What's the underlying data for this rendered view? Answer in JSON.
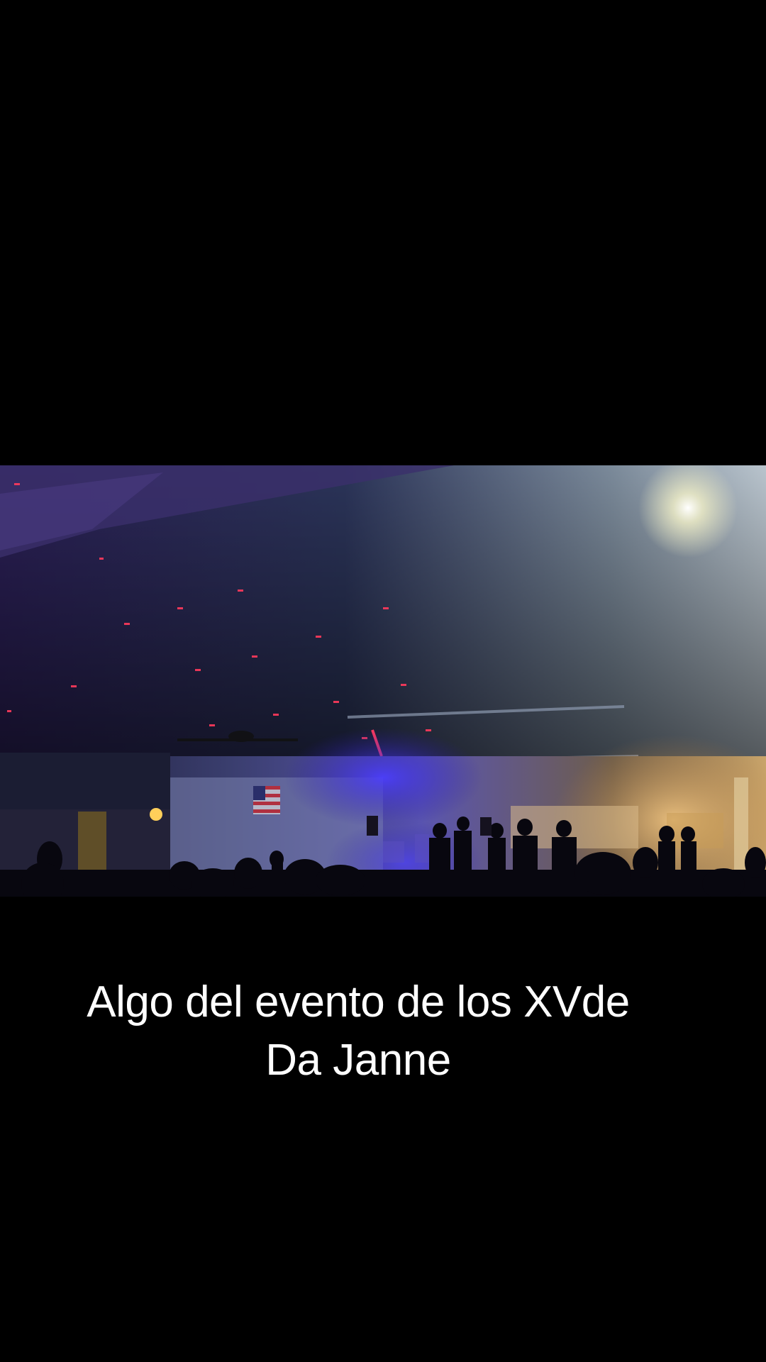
{
  "video": {
    "scene": "party-hall-video-frame"
  },
  "caption": {
    "line1": "Algo del evento de los XVde",
    "line2": "Da Janne"
  },
  "colors": {
    "background": "#000000",
    "caption_text": "#ffffff",
    "stage_light_blue": "#3b2cff",
    "warm_light": "#f2c27a",
    "laser_red": "#ff3a5c"
  }
}
